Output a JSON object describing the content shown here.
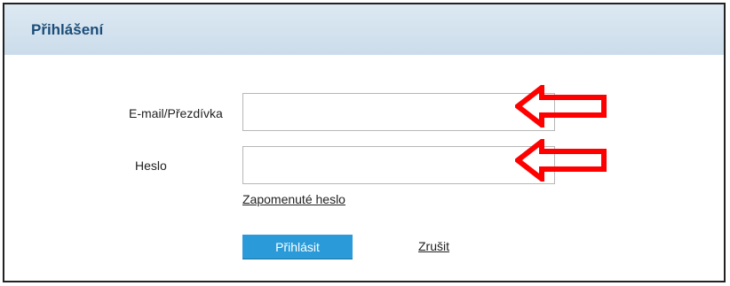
{
  "panel": {
    "title": "Přihlášení"
  },
  "form": {
    "email_label": "E-mail/Přezdívka",
    "email_value": "",
    "email_placeholder": "",
    "password_label": "Heslo",
    "password_value": "",
    "password_placeholder": "",
    "forgot_link": "Zapomenuté heslo",
    "submit_label": "Přihlásit",
    "cancel_label": "Zrušit"
  },
  "colors": {
    "header_bg": "#d3e2ee",
    "title_text": "#1c4d79",
    "submit_bg": "#2a9bd8",
    "arrow": "#ff0000"
  },
  "annotations": {
    "arrow_icon": "left-arrow-icon"
  }
}
